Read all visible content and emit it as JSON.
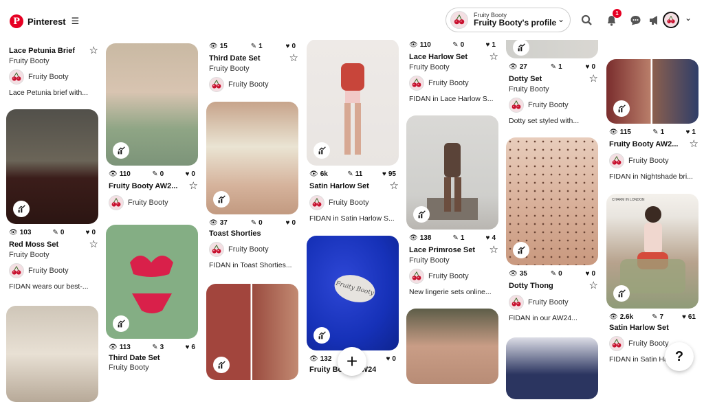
{
  "header": {
    "brand": "Pinterest",
    "profile_small": "Fruity Booty",
    "profile_big": "Fruity Booty's profile",
    "notif_count": "1"
  },
  "owner": "Fruity Booty",
  "fab": {
    "plus": "+",
    "help": "?"
  },
  "pins": {
    "c1a": {
      "title": "Lace Petunia Brief",
      "sub": "Fruity Booty",
      "desc": "Lace Petunia brief with..."
    },
    "c1b": {
      "views": "103",
      "saves": "0",
      "reacts": "0",
      "title": "Red Moss Set",
      "sub": "Fruity Booty",
      "desc": "FIDAN wears our best-..."
    },
    "c2a": {
      "views": "110",
      "saves": "0",
      "reacts": "0",
      "title": "Fruity Booty AW2...",
      "sub": "Fruity Booty"
    },
    "c2b": {
      "views": "113",
      "saves": "3",
      "reacts": "6",
      "title": "Third Date Set",
      "sub": "Fruity Booty"
    },
    "c3a": {
      "views": "15",
      "saves": "1",
      "reacts": "0",
      "title": "Third Date Set",
      "sub": "Fruity Booty"
    },
    "c3b": {
      "views": "37",
      "saves": "0",
      "reacts": "0",
      "title": "Toast Shorties",
      "desc": "FIDAN in Toast Shorties..."
    },
    "c4a": {
      "views": "6k",
      "saves": "11",
      "reacts": "95",
      "title": "Satin Harlow Set",
      "desc": "FIDAN in Satin Harlow S..."
    },
    "c4b": {
      "views": "132",
      "saves": "",
      "reacts": "0",
      "title": "Fruity Booty AW24"
    },
    "c5a": {
      "views": "110",
      "saves": "0",
      "reacts": "1",
      "title": "Lace Harlow Set",
      "sub": "Fruity Booty",
      "desc": "FIDAN in Lace Harlow S..."
    },
    "c5b": {
      "views": "138",
      "saves": "1",
      "reacts": "4",
      "title": "Lace Primrose Set",
      "sub": "Fruity Booty",
      "desc": "New lingerie sets online..."
    },
    "c6a": {
      "views": "27",
      "saves": "1",
      "reacts": "0",
      "title": "Dotty Set",
      "sub": "Fruity Booty",
      "desc": "Dotty set styled with..."
    },
    "c6b": {
      "views": "35",
      "saves": "0",
      "reacts": "0",
      "title": "Dotty Thong",
      "desc": "FIDAN in our AW24..."
    },
    "c7a": {
      "views": "115",
      "saves": "1",
      "reacts": "1",
      "title": "Fruity Booty AW2...",
      "desc": "FIDAN in Nightshade bri..."
    },
    "c7b": {
      "views": "2.6k",
      "saves": "7",
      "reacts": "61",
      "title": "Satin Harlow Set",
      "desc": "FIDAN in Satin Ha..."
    }
  },
  "image_text": {
    "packet": "Fruity Booty",
    "magazine": "CHARM IN LONDON"
  },
  "icons": [
    "pinterest-logo",
    "menu-icon",
    "search-icon",
    "bell-icon",
    "chat-icon",
    "megaphone-icon",
    "stats-icon",
    "star-icon",
    "eye-icon",
    "pin-icon",
    "heart-icon",
    "plus-icon",
    "help-icon",
    "chevron-down-icon",
    "cherry-icon"
  ],
  "colors": {
    "brand": "#e60023",
    "cherry": "#c8102e"
  }
}
